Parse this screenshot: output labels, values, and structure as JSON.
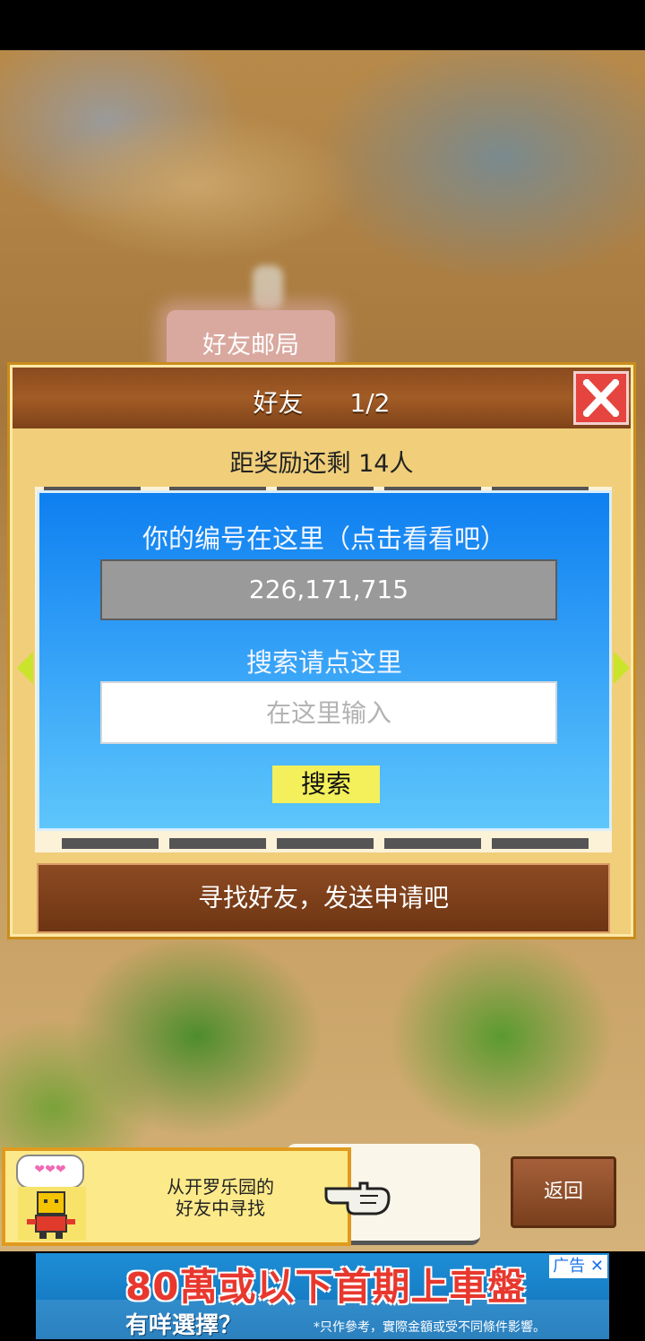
{
  "background": {
    "sign_label": "好友邮局"
  },
  "dialog": {
    "title": "好友",
    "page": "1/2",
    "progress_text": "距奖励还剩 14人",
    "panel": {
      "id_label": "你的编号在这里（点击看看吧）",
      "user_id": "226,171,715",
      "search_label": "搜索请点这里",
      "search_placeholder": "在这里输入",
      "search_button": "搜索"
    },
    "find_button": "寻找好友，发送申请吧"
  },
  "bottom": {
    "tip_line1": "从开罗乐园的",
    "tip_line2": "好友中寻找",
    "hearts": "❤❤❤",
    "back_button": "返回"
  },
  "ad": {
    "headline": "80萬或以下首期上車盤",
    "subline": "有咩選擇？",
    "fine_print": "*只作參考，實際金額或受不同條件影響。",
    "label": "广告",
    "close": "✕"
  },
  "colors": {
    "panel_blue": "#0e7ff0",
    "search_button": "#f4f05b",
    "close_red": "#e6453f",
    "dialog_gold": "#f0ce7a"
  }
}
